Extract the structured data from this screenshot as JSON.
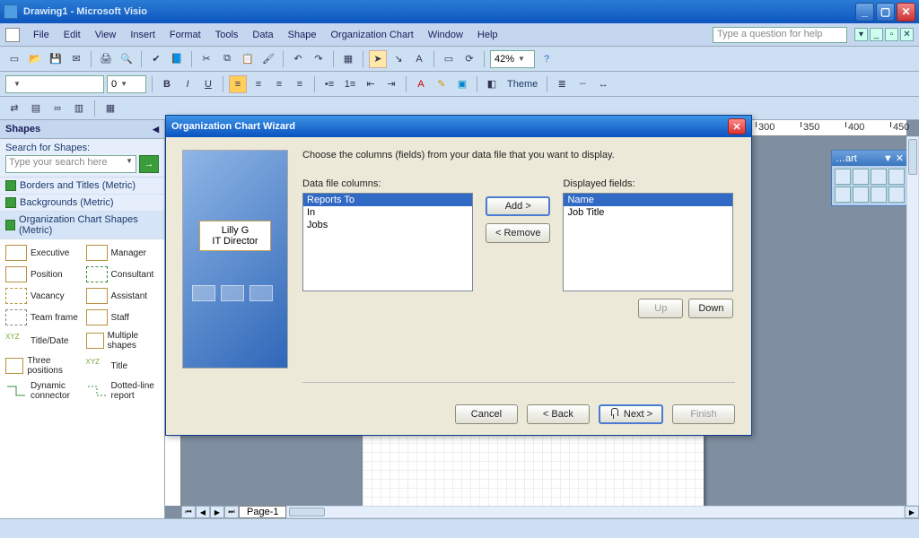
{
  "titlebar": {
    "title": "Drawing1 - Microsoft Visio"
  },
  "menu": {
    "items": [
      "File",
      "Edit",
      "View",
      "Insert",
      "Format",
      "Tools",
      "Data",
      "Shape",
      "Organization Chart",
      "Window",
      "Help"
    ],
    "help_placeholder": "Type a question for help"
  },
  "toolbar": {
    "zoom": "42%"
  },
  "format_toolbar": {
    "font_size": "0",
    "theme_label": "Theme"
  },
  "shapes_panel": {
    "title": "Shapes",
    "search_label": "Search for Shapes:",
    "search_placeholder": "Type your search here",
    "stencils": [
      "Borders and Titles (Metric)",
      "Backgrounds (Metric)",
      "Organization Chart Shapes (Metric)"
    ],
    "shapes": [
      {
        "label": "Executive"
      },
      {
        "label": "Manager"
      },
      {
        "label": "Position"
      },
      {
        "label": "Consultant"
      },
      {
        "label": "Vacancy"
      },
      {
        "label": "Assistant"
      },
      {
        "label": "Team frame"
      },
      {
        "label": "Staff"
      },
      {
        "label": "Title/Date"
      },
      {
        "label": "Multiple shapes"
      },
      {
        "label": "Three positions"
      },
      {
        "label": "Title"
      },
      {
        "label": "Dynamic connector"
      },
      {
        "label": "Dotted-line report"
      }
    ]
  },
  "canvas": {
    "page_tab": "Page-1",
    "float_toolbar_title": "…art"
  },
  "dialog": {
    "title": "Organization Chart Wizard",
    "instruction": "Choose the columns (fields) from your data file that you want to display.",
    "illus_name": "Lilly G",
    "illus_role": "IT Director",
    "left_label": "Data file columns:",
    "right_label": "Displayed fields:",
    "left_items": [
      "Reports To",
      "In",
      "Jobs"
    ],
    "left_selected_index": 0,
    "right_items": [
      "Name",
      "Job Title"
    ],
    "right_selected_index": 0,
    "add_label": "Add >",
    "remove_label": "< Remove",
    "up_label": "Up",
    "down_label": "Down",
    "cancel_label": "Cancel",
    "back_label": "< Back",
    "next_label": "Next >",
    "finish_label": "Finish"
  }
}
